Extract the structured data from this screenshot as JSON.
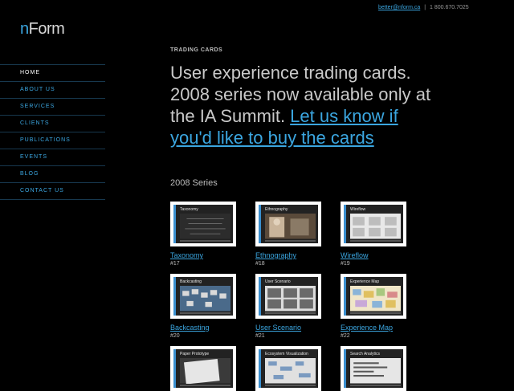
{
  "topbar": {
    "email": "better@nform.ca",
    "separator": "|",
    "phone": "1 800.670.7025"
  },
  "logo": {
    "first": "n",
    "rest": "Form"
  },
  "nav": [
    {
      "label": "HOME",
      "active": true
    },
    {
      "label": "ABOUT US"
    },
    {
      "label": "SERVICES"
    },
    {
      "label": "CLIENTS"
    },
    {
      "label": "PUBLICATIONS"
    },
    {
      "label": "EVENTS"
    },
    {
      "label": "BLOG"
    },
    {
      "label": "CONTACT US"
    }
  ],
  "main": {
    "section_label": "TRADING CARDS",
    "headline_text": "User experience trading cards. 2008 series now available only at the IA Summit. ",
    "headline_link": "Let us know if you'd like to buy the cards",
    "series_title": "2008 Series"
  },
  "cards": [
    {
      "title": "Taxonomy",
      "name": "Taxonomy",
      "number": "#17"
    },
    {
      "title": "Ethnography",
      "name": "Ethnography",
      "number": "#18"
    },
    {
      "title": "Wireflow",
      "name": "Wireflow",
      "number": "#19"
    },
    {
      "title": "Backcasting",
      "name": "Backcasting",
      "number": "#20"
    },
    {
      "title": "User Scenario",
      "name": "User Scenario",
      "number": "#21"
    },
    {
      "title": "Experience Map",
      "name": "Experience Map",
      "number": "#22"
    },
    {
      "title": "Paper Prototype",
      "name": "",
      "number": ""
    },
    {
      "title": "Ecosystem Visualization",
      "name": "",
      "number": ""
    },
    {
      "title": "Search Analytics",
      "name": "",
      "number": ""
    }
  ],
  "colors": {
    "accent": "#3ba6e0",
    "background": "#000000",
    "rule": "#17384e"
  }
}
